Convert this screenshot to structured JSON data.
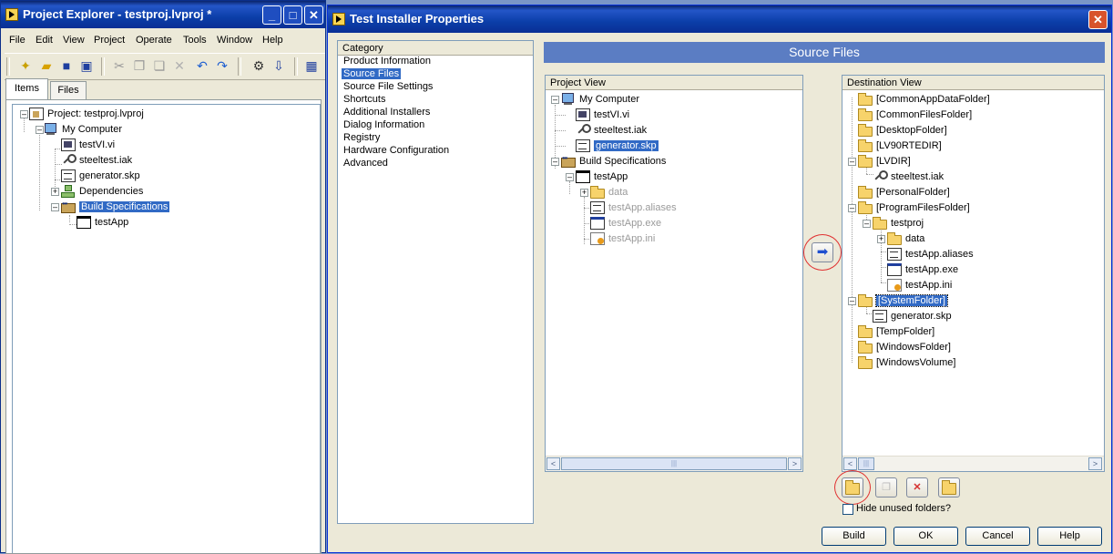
{
  "project_explorer": {
    "title": "Project Explorer - testproj.lvproj *",
    "title_buttons": {
      "minimize": "_",
      "maximize": "□",
      "close": "✕"
    },
    "menu": [
      "File",
      "Edit",
      "View",
      "Project",
      "Operate",
      "Tools",
      "Window",
      "Help"
    ],
    "toolbar_icons": [
      "new-icon",
      "open-folder-icon",
      "save-icon",
      "save-all-icon",
      "cut-icon",
      "copy-icon",
      "paste-icon",
      "delete-icon",
      "undo-icon",
      "redo-icon",
      "build-icon",
      "deploy-icon",
      "window-icon"
    ],
    "tabs": [
      "Items",
      "Files"
    ],
    "tree": [
      {
        "label": "Project: testproj.lvproj",
        "icon": "proj"
      },
      {
        "label": "My Computer",
        "icon": "computer"
      },
      {
        "label": "testVI.vi",
        "icon": "vi"
      },
      {
        "label": "steeltest.iak",
        "icon": "key"
      },
      {
        "label": "generator.skp",
        "icon": "skp"
      },
      {
        "label": "Dependencies",
        "icon": "dep"
      },
      {
        "label": "Build Specifications",
        "icon": "build",
        "selected": true
      },
      {
        "label": "testApp",
        "icon": "app"
      }
    ]
  },
  "installer": {
    "title": "Test Installer Properties",
    "close_glyph": "✕",
    "category": {
      "header": "Category",
      "items": [
        "Product Information",
        "Source Files",
        "Source File Settings",
        "Shortcuts",
        "Additional Installers",
        "Dialog Information",
        "Registry",
        "Hardware Configuration",
        "Advanced"
      ],
      "selected_index": 1
    },
    "banner": "Source Files",
    "project_view": {
      "header": "Project View",
      "nodes": [
        {
          "label": "My Computer",
          "icon": "computer"
        },
        {
          "label": "testVI.vi",
          "icon": "vi"
        },
        {
          "label": "steeltest.iak",
          "icon": "key"
        },
        {
          "label": "generator.skp",
          "icon": "skp",
          "selected": true
        },
        {
          "label": "Build Specifications",
          "icon": "build"
        },
        {
          "label": "testApp",
          "icon": "app"
        },
        {
          "label": "data",
          "icon": "folder",
          "dim": true
        },
        {
          "label": "testApp.aliases",
          "icon": "skp",
          "dim": true
        },
        {
          "label": "testApp.exe",
          "icon": "exe",
          "dim": true
        },
        {
          "label": "testApp.ini",
          "icon": "ini",
          "dim": true
        }
      ]
    },
    "add_arrow_glyph": "➡",
    "destination_view": {
      "header": "Destination View",
      "nodes": [
        {
          "label": "[CommonAppDataFolder]",
          "icon": "folder"
        },
        {
          "label": "[CommonFilesFolder]",
          "icon": "folder"
        },
        {
          "label": "[DesktopFolder]",
          "icon": "folder"
        },
        {
          "label": "[LV90RTEDIR]",
          "icon": "folder"
        },
        {
          "label": "[LVDIR]",
          "icon": "folder"
        },
        {
          "label": "steeltest.iak",
          "icon": "key"
        },
        {
          "label": "[PersonalFolder]",
          "icon": "folder"
        },
        {
          "label": "[ProgramFilesFolder]",
          "icon": "folder"
        },
        {
          "label": "testproj",
          "icon": "folder"
        },
        {
          "label": "data",
          "icon": "folder"
        },
        {
          "label": "testApp.aliases",
          "icon": "skp"
        },
        {
          "label": "testApp.exe",
          "icon": "exe"
        },
        {
          "label": "testApp.ini",
          "icon": "ini"
        },
        {
          "label": "[SystemFolder]",
          "icon": "folder",
          "selected": true
        },
        {
          "label": "generator.skp",
          "icon": "skp"
        },
        {
          "label": "[TempFolder]",
          "icon": "folder"
        },
        {
          "label": "[WindowsFolder]",
          "icon": "folder"
        },
        {
          "label": "[WindowsVolume]",
          "icon": "folder"
        }
      ]
    },
    "dest_buttons": [
      "add-folder-icon",
      "rename-icon",
      "remove-icon",
      "folder-properties-icon"
    ],
    "remove_glyph": "✕",
    "hide_unused_label": "Hide unused folders?",
    "hide_unused_checked": false,
    "footer_buttons": [
      "Build",
      "OK",
      "Cancel",
      "Help"
    ],
    "scroll_glyphs": {
      "left": "<",
      "right": ">",
      "grip": "|||"
    }
  }
}
